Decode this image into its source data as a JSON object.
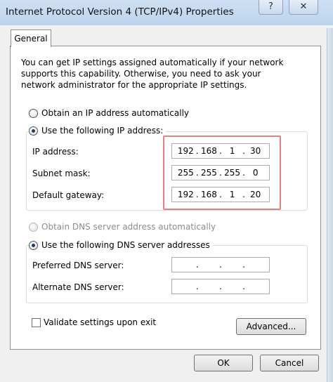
{
  "window": {
    "title": "Internet Protocol Version 4 (TCP/IPv4) Properties",
    "help_glyph": "?",
    "close_glyph": "✕"
  },
  "tab": {
    "label": "General"
  },
  "description": "You can get IP settings assigned automatically if your network supports this capability. Otherwise, you need to ask your network administrator for the appropriate IP settings.",
  "ip_mode": {
    "auto_label": "Obtain an IP address automatically",
    "manual_label": "Use the following IP address:",
    "selected": "manual"
  },
  "ip_fields": {
    "ip_address": {
      "label": "IP address:",
      "octets": [
        "192",
        "168",
        "1",
        "30"
      ]
    },
    "subnet_mask": {
      "label": "Subnet mask:",
      "octets": [
        "255",
        "255",
        "255",
        "0"
      ]
    },
    "default_gateway": {
      "label": "Default gateway:",
      "octets": [
        "192",
        "168",
        "1",
        "20"
      ]
    }
  },
  "dns_mode": {
    "auto_label": "Obtain DNS server address automatically",
    "manual_label": "Use the following DNS server addresses",
    "selected": "manual"
  },
  "dns_fields": {
    "preferred": {
      "label": "Preferred DNS server:",
      "octets": [
        "",
        "",
        "",
        ""
      ]
    },
    "alternate": {
      "label": "Alternate DNS server:",
      "octets": [
        "",
        "",
        "",
        ""
      ]
    }
  },
  "validate": {
    "label": "Validate settings upon exit",
    "checked": false
  },
  "buttons": {
    "advanced": "Advanced...",
    "ok": "OK",
    "cancel": "Cancel"
  },
  "colors": {
    "highlight_border": "#e87f7f",
    "titlebar": "#c6dbf1"
  }
}
